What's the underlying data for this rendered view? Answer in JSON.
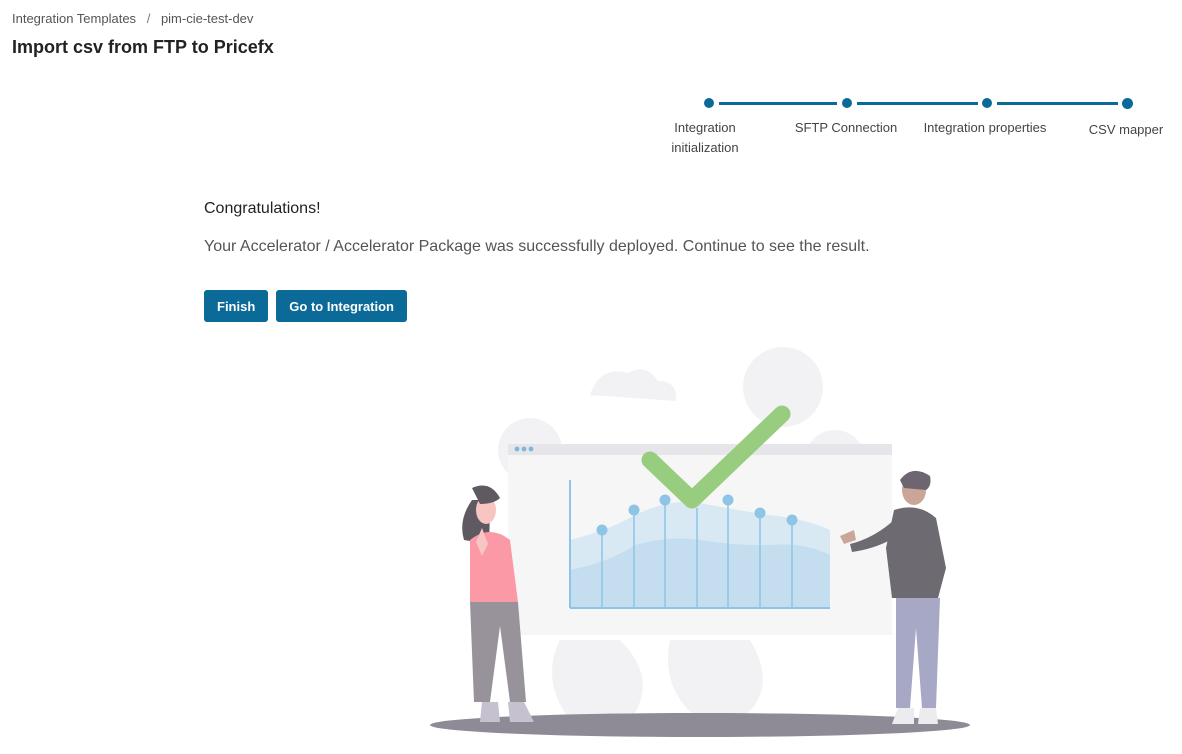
{
  "breadcrumb": {
    "parent": "Integration Templates",
    "separator": "/",
    "current": "pim-cie-test-dev"
  },
  "page": {
    "title": "Import csv from FTP to Pricefx"
  },
  "stepper": {
    "steps": [
      {
        "label_line1": "Integration",
        "label_line2": "initialization"
      },
      {
        "label_line1": "SFTP Connection"
      },
      {
        "label_line1": "Integration properties"
      },
      {
        "label_line1": "CSV mapper"
      }
    ]
  },
  "result": {
    "heading": "Congratulations!",
    "message": "Your Accelerator / Accelerator Package was successfully deployed. Continue to see the result."
  },
  "actions": {
    "finish_label": "Finish",
    "go_to_integration_label": "Go to Integration"
  },
  "colors": {
    "primary": "#0b6a97",
    "success_check": "#98cd80",
    "chart_blue": "#8ec5e6"
  },
  "illustration": {
    "name": "success-illustration"
  }
}
